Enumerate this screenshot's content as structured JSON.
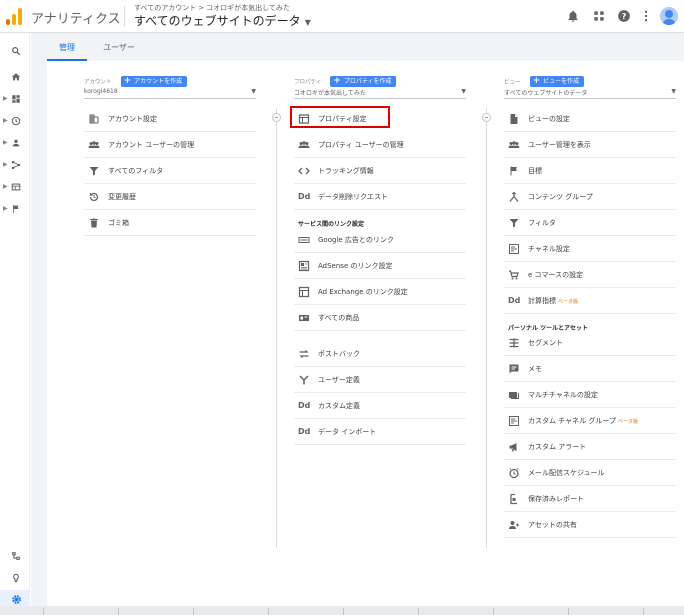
{
  "app": {
    "name": "アナリティクス",
    "breadcrumb": [
      "すべてのアカウント",
      "コオロギが本気出してみた"
    ],
    "breadcrumb_sep": ">",
    "view_title": "すべてのウェブサイトのデータ"
  },
  "top_icons": [
    "bell-icon",
    "apps-grid-icon",
    "help-icon",
    "more-vert-icon",
    "avatar"
  ],
  "left_nav": [
    "search-icon",
    "home-icon",
    "dashboard-icon",
    "clock-icon",
    "person-icon",
    "acquisition-icon",
    "behavior-icon",
    "flag-icon",
    "attribution-icon",
    "lightbulb-icon",
    "gear-icon"
  ],
  "tabs": [
    {
      "label": "管理",
      "active": true
    },
    {
      "label": "ユーザー",
      "active": false
    }
  ],
  "account": {
    "label": "アカウント",
    "create_button": "アカウントを作成",
    "selected": "korogi4618",
    "items": [
      {
        "icon": "building-icon",
        "label": "アカウント設定"
      },
      {
        "icon": "people-icon",
        "label": "アカウント ユーザーの管理"
      },
      {
        "icon": "filter-icon",
        "label": "すべてのフィルタ"
      },
      {
        "icon": "history-icon",
        "label": "変更履歴"
      },
      {
        "icon": "trash-icon",
        "label": "ゴミ箱"
      }
    ]
  },
  "property": {
    "label": "プロパティ",
    "create_button": "プロパティを作成",
    "selected": "コオロギが本気出してみた",
    "items": [
      {
        "icon": "property-settings-icon",
        "label": "プロパティ設定",
        "highlighted": true
      },
      {
        "icon": "people-icon",
        "label": "プロパティ ユーザーの管理"
      },
      {
        "icon": "code-icon",
        "label": "トラッキング情報"
      },
      {
        "icon": "dd-icon",
        "label": "データ削除リクエスト"
      }
    ],
    "section_title": "サービス間のリンク設定",
    "link_items": [
      {
        "icon": "google-ads-icon",
        "label": "Google 広告とのリンク"
      },
      {
        "icon": "adsense-icon",
        "label": "AdSense のリンク設定"
      },
      {
        "icon": "ad-exchange-icon",
        "label": "Ad Exchange のリンク設定"
      },
      {
        "icon": "products-icon",
        "label": "すべての商品"
      }
    ],
    "more_items": [
      {
        "icon": "postback-icon",
        "label": "ポストバック"
      },
      {
        "icon": "audience-icon",
        "label": "ユーザー定義"
      },
      {
        "icon": "dd-icon",
        "label": "カスタム定義"
      },
      {
        "icon": "dd-icon",
        "label": "データ インポート"
      }
    ]
  },
  "view": {
    "label": "ビュー",
    "create_button": "ビューを作成",
    "selected": "すべてのウェブサイトのデータ",
    "items": [
      {
        "icon": "document-icon",
        "label": "ビューの設定"
      },
      {
        "icon": "people-icon",
        "label": "ユーザー管理を表示"
      },
      {
        "icon": "flag-icon",
        "label": "目標"
      },
      {
        "icon": "content-group-icon",
        "label": "コンテンツ グループ"
      },
      {
        "icon": "filter-icon",
        "label": "フィルタ"
      },
      {
        "icon": "channel-icon",
        "label": "チャネル設定"
      },
      {
        "icon": "cart-icon",
        "label": "e コマースの設定"
      },
      {
        "icon": "dd-icon",
        "label": "計算指標",
        "beta": "ベータ版"
      }
    ],
    "section_title": "パーソナル ツールとアセット",
    "personal_items": [
      {
        "icon": "segment-icon",
        "label": "セグメント"
      },
      {
        "icon": "note-icon",
        "label": "メモ"
      },
      {
        "icon": "multi-channel-icon",
        "label": "マルチチャネルの設定"
      },
      {
        "icon": "custom-channel-icon",
        "label": "カスタム チャネル グループ",
        "beta": "ベータ版"
      },
      {
        "icon": "megaphone-icon",
        "label": "カスタム アラート"
      },
      {
        "icon": "alarm-icon",
        "label": "メール配信スケジュール"
      },
      {
        "icon": "saved-report-icon",
        "label": "保存済みレポート"
      },
      {
        "icon": "share-icon",
        "label": "アセットの共有"
      }
    ]
  },
  "colors": {
    "accent": "#1a73e8",
    "button": "#4285f4",
    "highlight": "#e00000",
    "beta": "#e37400"
  }
}
